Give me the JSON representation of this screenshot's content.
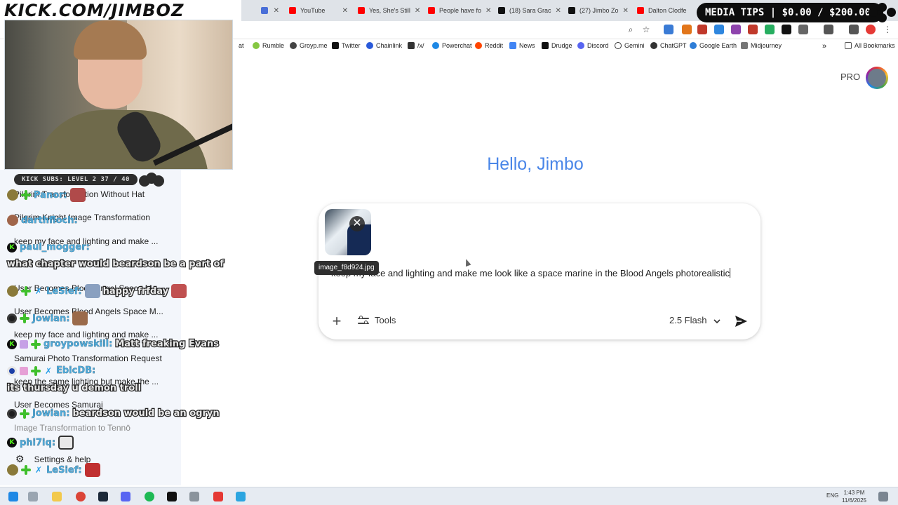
{
  "overlay": {
    "logo_text": "KICK.COM/JIMBOZ",
    "media_tips": "MEDIA TIPS | $0.00 / $200.00",
    "subs_bar": "KICK SUBS: LEVEL 2 37 / 40"
  },
  "browser": {
    "tabs": [
      {
        "label": "YouTube",
        "color": "#ff0000"
      },
      {
        "label": "Yes, She's Still",
        "color": "#ff0000"
      },
      {
        "label": "People have fo",
        "color": "#ff0000"
      },
      {
        "label": "(18) Sara Grac",
        "color": "#111111"
      },
      {
        "label": "(27) Jimbo Zo",
        "color": "#111111"
      },
      {
        "label": "Dalton Clodfe",
        "color": "#ff0000"
      }
    ],
    "bookmarks": [
      {
        "label": "at",
        "icon": "bookmark-icon"
      },
      {
        "label": "Rumble",
        "icon": "rumble-icon"
      },
      {
        "label": "Groyp.me",
        "icon": "groyp-icon"
      },
      {
        "label": "Twitter",
        "icon": "x-icon"
      },
      {
        "label": "Chainlink",
        "icon": "chainlink-icon"
      },
      {
        "label": "/x/",
        "icon": "x-board-icon"
      },
      {
        "label": "Powerchat",
        "icon": "powerchat-icon"
      },
      {
        "label": "Reddit",
        "icon": "reddit-icon"
      },
      {
        "label": "News",
        "icon": "news-icon"
      },
      {
        "label": "Drudge",
        "icon": "drudge-icon"
      },
      {
        "label": "Discord",
        "icon": "discord-icon"
      },
      {
        "label": "Gemini",
        "icon": "search-icon"
      },
      {
        "label": "ChatGPT",
        "icon": "chatgpt-icon"
      },
      {
        "label": "Google Earth",
        "icon": "earth-icon"
      },
      {
        "label": "Midjourney",
        "icon": "midjourney-icon"
      }
    ],
    "all_bookmarks": "All Bookmarks"
  },
  "sidebar": {
    "recents": [
      "Pilgrim Transformation Without Hat",
      "Pilgrim Knight Image Transformation",
      "keep my face and lighting and make ...",
      "User Becomes Blood Angel Space M...",
      "User Becomes Blood Angels Space M...",
      "keep my face and lighting and make ...",
      "Samurai Photo Transformation Request",
      "keep the same lighting but make the ...",
      "User Becomes Samurai",
      "Image Transformation to Tennō"
    ],
    "settings_label": "Settings & help"
  },
  "chat": [
    {
      "user": "Panor:",
      "msg": ""
    },
    {
      "user": "darthfloch:",
      "msg": ""
    },
    {
      "user": "paul_mogger:",
      "msg": ""
    },
    {
      "user": "",
      "msg": "what chapter would beardson be a part of"
    },
    {
      "user": "LeSief:",
      "msg": "happy frfday"
    },
    {
      "user": "Jowian:",
      "msg": ""
    },
    {
      "user": "groypowskill:",
      "msg": "Matt freaking Evans"
    },
    {
      "user": "EbicDB:",
      "msg": ""
    },
    {
      "user": "",
      "msg": "its thursday u demon troll"
    },
    {
      "user": "Jowian:",
      "msg": "beardson would be an ogryn"
    },
    {
      "user": "phi7iq:",
      "msg": ""
    },
    {
      "user": "LeSief:",
      "msg": ""
    }
  ],
  "gemini": {
    "plan_label": "PRO",
    "greeting": "Hello, Jimbo",
    "attachment_name": "image_f8d924.jpg",
    "prompt_text": "keep my face and lighting and make me look like a space marine in the Blood Angels photorealistic",
    "tools_label": "Tools",
    "model_label": "2.5 Flash"
  },
  "taskbar": {
    "lang": "ENG",
    "time": "1:43 PM",
    "date": "11/6/2025"
  }
}
